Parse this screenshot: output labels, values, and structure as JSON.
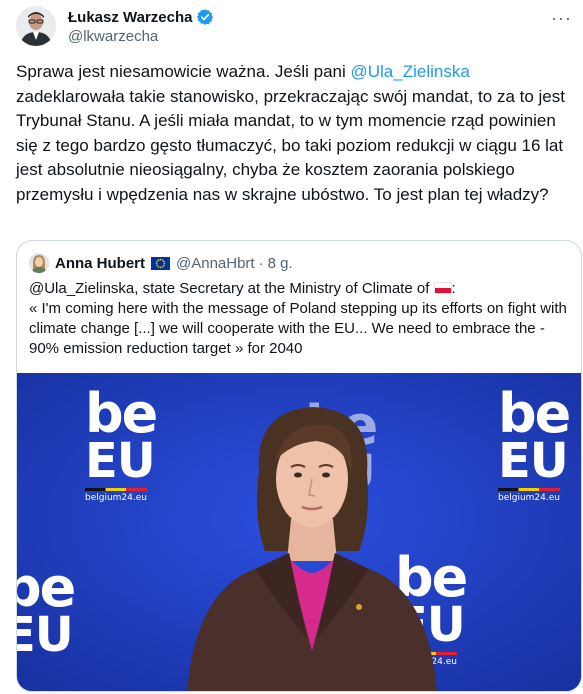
{
  "author": {
    "name": "Łukasz Warzecha",
    "handle": "@lkwarzecha",
    "verified": true,
    "avatar_icon": "avatar-photo"
  },
  "more_label": "···",
  "tweet": {
    "text_before": "Sprawa jest niesamowicie ważna. Jeśli pani ",
    "mention": "@Ula_Zielinska",
    "text_after": " zadeklarowała takie stanowisko, przekraczając swój mandat, to za to jest Trybunał Stanu. A jeśli miała mandat, to w tym momencie rząd powinien się z tego bardzo gęsto tłumaczyć, bo taki poziom redukcji w ciągu 16 lat jest absolutnie nieosiągalny, chyba że kosztem zaorania polskiego przemysłu i wpędzenia nas w skrajne ubóstwo. To jest plan tej władzy?"
  },
  "quote": {
    "author_name": "Anna Hubert",
    "author_flag_icon": "eu-flag-icon",
    "author_handle": "@AnnaHbrt",
    "separator": "·",
    "time": "8 g.",
    "text_line1": "@Ula_Zielinska, state Secretary at the Ministry of Climate of ",
    "poland_flag_icon": "poland-flag-icon",
    "text_line1_end": ":",
    "text_rest": "« I'm coming here with the message of Poland stepping up its efforts on fight with climate change [...] we will cooperate with the EU... We need to embrace the - 90% emission reduction target » for 2040"
  },
  "video": {
    "logo_be": "be",
    "logo_eu": "EU",
    "logo_site": "belgium24.eu"
  },
  "colors": {
    "accent": "#1d9bf0",
    "text": "#0f1419",
    "secondary": "#536471",
    "backdrop_blue": "#1f3fc4",
    "border": "#cfd9de"
  }
}
